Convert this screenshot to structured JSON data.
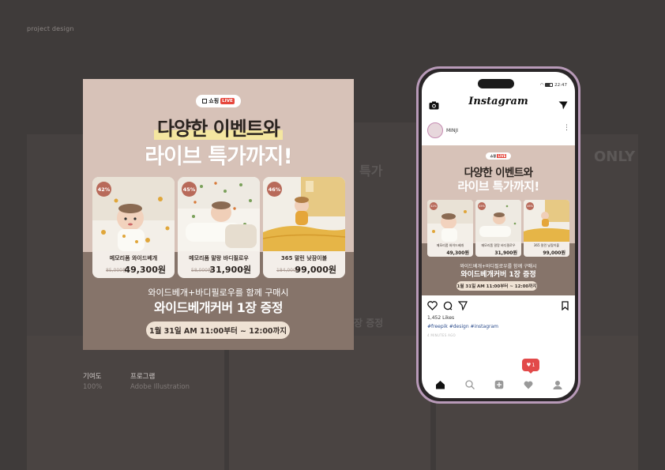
{
  "page": {
    "label": "project design"
  },
  "banner": {
    "logo_text": "쇼핑",
    "logo_live": "LIVE",
    "headline1": "다양한 이벤트와",
    "headline2": "라이브 특가까지!",
    "products": [
      {
        "badge": "42%",
        "name": "메모리폼 와이드베개",
        "old_price": "85,000원",
        "price": "49,300원"
      },
      {
        "badge": "45%",
        "name": "메모리폼 말랑 바디필로우",
        "old_price": "58,000원",
        "price": "31,900원"
      },
      {
        "badge": "46%",
        "name": "365 말린 낮잠이불",
        "old_price": "184,000원",
        "price": "99,000원"
      }
    ],
    "event_line1": "와이드베개+바디필로우를 함께 구매시",
    "event_line2": "와이드베개커버 1장 증정",
    "event_time": "1월 31일 AM 11:00부터 ~ 12:00까지"
  },
  "project_info": {
    "contribution_label": "기여도",
    "contribution_value": "100%",
    "program_label": "프로그램",
    "program_value": "Adobe Illustration"
  },
  "phone": {
    "status_time": "22:47",
    "app_title": "Instagram",
    "username": "MINJI",
    "post": {
      "headline1": "다양한 이벤트와",
      "headline2": "라이브 특가까지!",
      "prices": [
        "49,300원",
        "31,900원",
        "99,000원"
      ],
      "event_line1": "와이드베개+바디필로우를 함께 구매시",
      "event_line2": "와이드베개커버 1장 증정",
      "event_time": "1월 31일 AM 11:00부터 ~ 12:00까지"
    },
    "likes": "1,452 Likes",
    "tags": "#freepik #design #instagram",
    "time_ago": "4 MINUTES AGO",
    "notification_count": "1"
  },
  "background": {
    "faint_text1": "ONLY",
    "faint_text2": "특가",
    "faint_text3": "장 증정"
  },
  "colors": {
    "background": "#3f3b3a",
    "banner_top": "#d7c2b8",
    "banner_bottom": "#86746a",
    "badge": "#b86a5a",
    "accent_red": "#e24a4a",
    "phone_frame": "#b89ab8"
  },
  "icons": [
    "camera-icon",
    "send-icon",
    "heart-icon",
    "comment-icon",
    "share-icon",
    "bookmark-icon",
    "home-icon",
    "search-icon",
    "add-icon",
    "activity-icon",
    "profile-icon"
  ]
}
